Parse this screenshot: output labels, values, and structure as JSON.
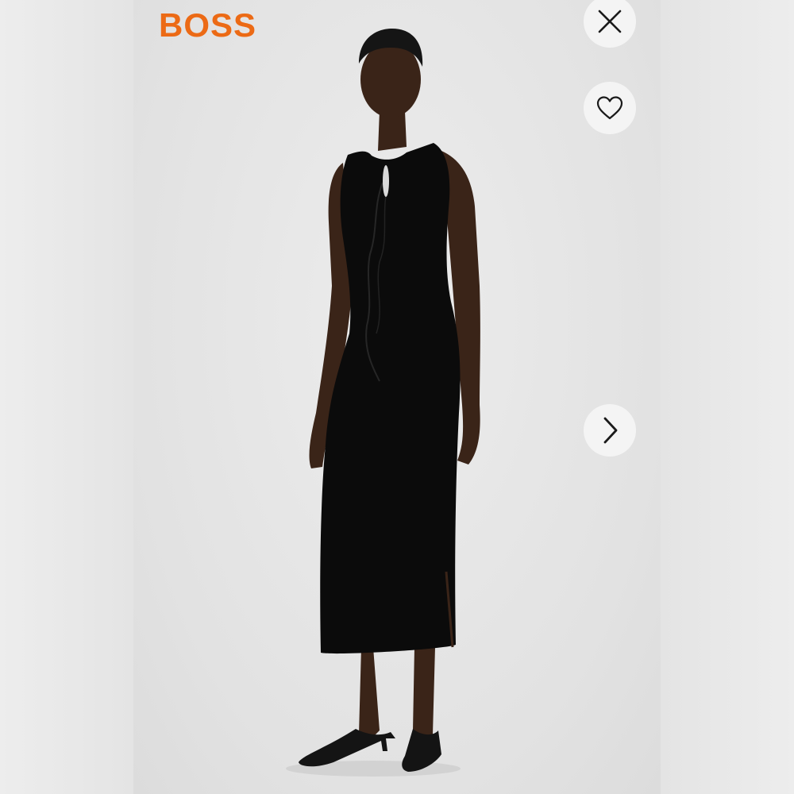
{
  "brand": {
    "logo_text": "BOSS",
    "accent_color": "#ec6a15"
  },
  "gallery": {
    "image_subject": "model-in-black-ruched-sleeveless-midi-dress",
    "icons": {
      "close": "close-icon",
      "favorite": "heart-icon",
      "next": "chevron-right-icon"
    }
  }
}
